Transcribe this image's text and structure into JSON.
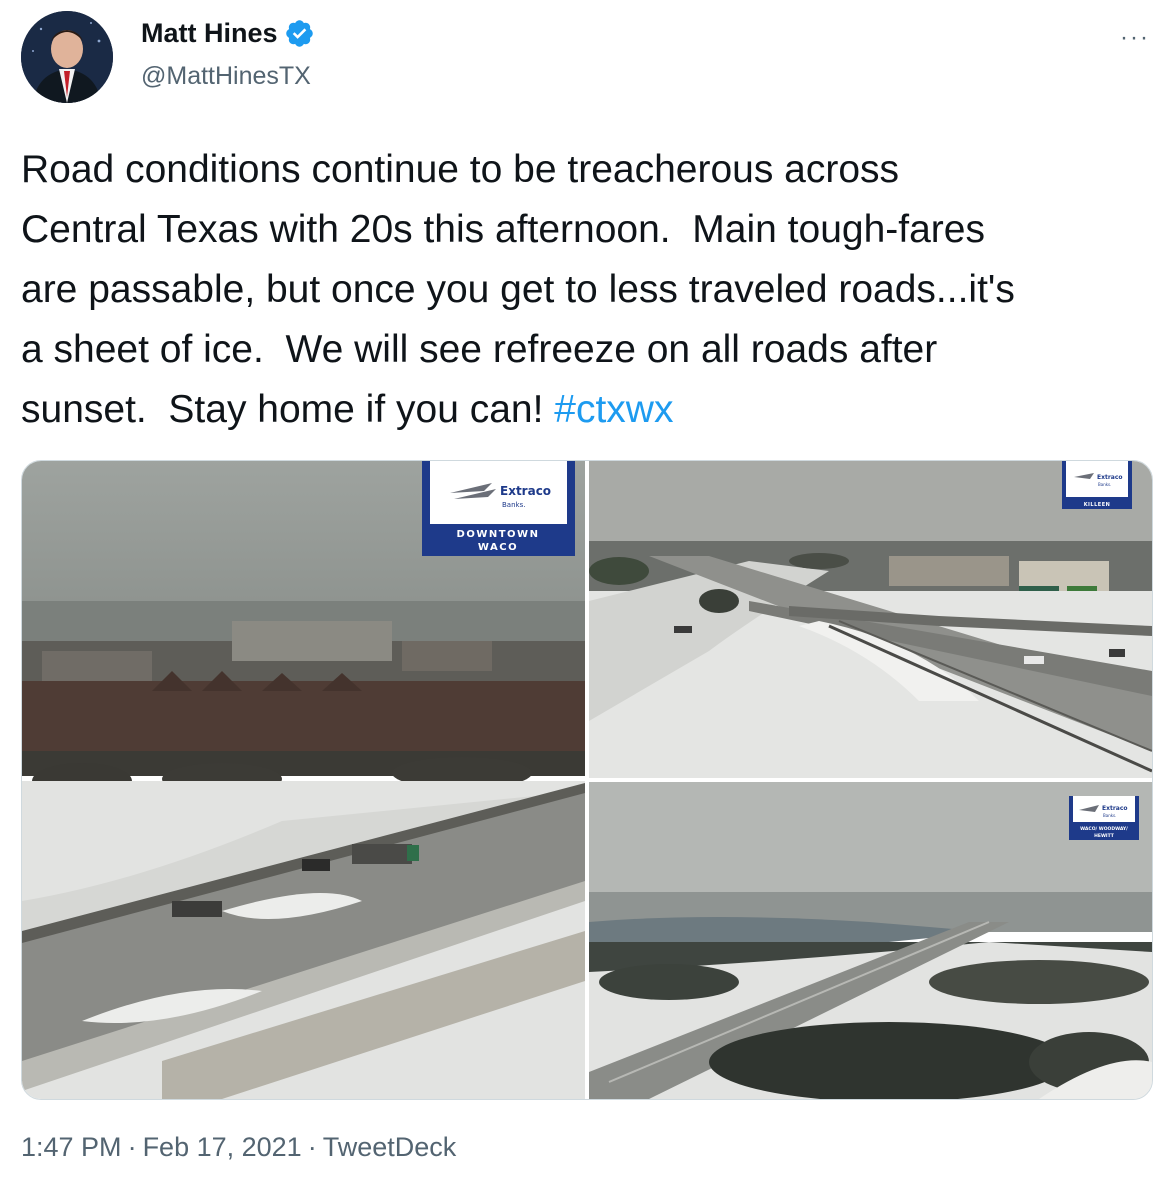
{
  "author": {
    "name": "Matt Hines",
    "handle": "@MattHinesTX",
    "verified": true,
    "avatar_icon": "profile-photo-avatar"
  },
  "more_icon": "more-options-icon",
  "more_label": "···",
  "tweet": {
    "text": "Road conditions continue to be treacherous across\nCentral Texas with 20s this afternoon.  Main tough-fares\nare passable, but once you get to less traveled roads...it's\na sheet of ice.  We will see refreeze on all roads after\nsunset.  Stay home if you can! ",
    "hashtag": "#ctxwx"
  },
  "media": {
    "images": [
      {
        "brand": "Extraco",
        "brand_sub": "Banks.",
        "location_line1": "DOWNTOWN",
        "location_line2": "WACO"
      },
      {
        "brand": "Extraco",
        "brand_sub": "Banks.",
        "location_line1": "KILLEEN",
        "location_line2": ""
      },
      {
        "brand": "Extraco",
        "brand_sub": "Banks.",
        "location_line1": "WACO/ WOODWAY/",
        "location_line2": "HEWITT"
      }
    ]
  },
  "meta": {
    "time": "1:47 PM",
    "separator": "·",
    "date": "Feb 17, 2021",
    "source": "TweetDeck"
  },
  "colors": {
    "link": "#1d9bf0",
    "secondary_text": "#536471",
    "verified_badge": "#1d9bf0",
    "sign_blue": "#1e3a8a"
  }
}
